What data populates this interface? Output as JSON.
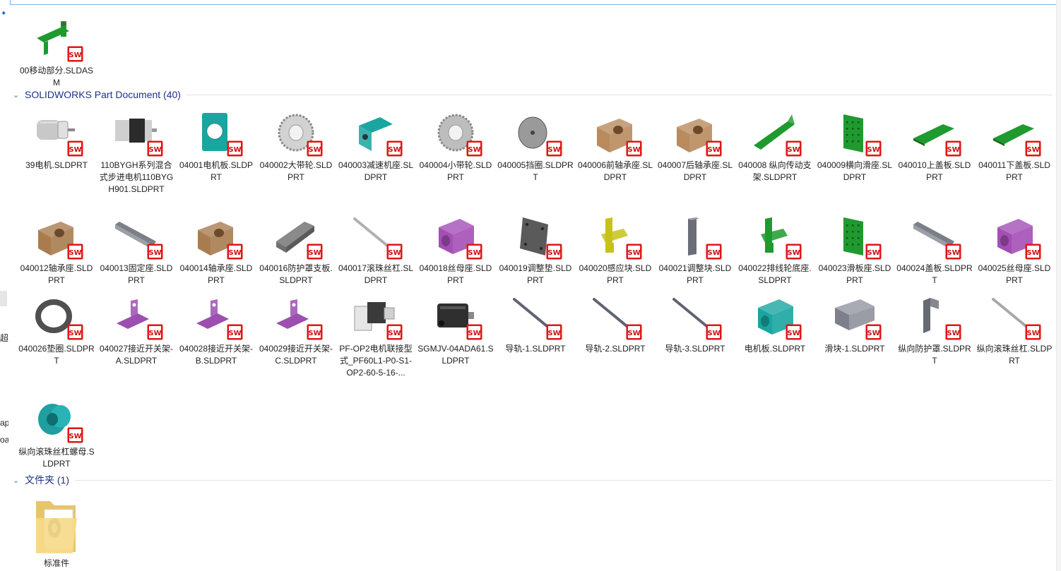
{
  "nav_fragments": [
    "超",
    "ap",
    "oa"
  ],
  "asm_item": {
    "label": "00移动部分.SLDASM",
    "color": "#1f9a2e",
    "shape": "assembly"
  },
  "group_parts": {
    "title": "SOLIDWORKS Part Document (40)"
  },
  "group_folder": {
    "title": "文件夹 (1)"
  },
  "sw_badge_text": "SW",
  "folder_item": {
    "label": "标准件",
    "shape": "folder"
  },
  "parts": [
    {
      "label": "39电机.SLDPRT",
      "color": "#c8c8c8",
      "shape": "motor"
    },
    {
      "label": "110BYGH系列混合式步进电机110BYGH901.SLDPRT",
      "color": "#2b2b2b",
      "shape": "stepper"
    },
    {
      "label": "04001电机板.SLDPRT",
      "color": "#19a5a0",
      "shape": "plate-hole"
    },
    {
      "label": "040002大带轮.SLDPRT",
      "color": "#d2d2d2",
      "shape": "gear"
    },
    {
      "label": "040003减速机座.SLDPRT",
      "color": "#19a5a0",
      "shape": "bracket"
    },
    {
      "label": "040004小带轮.SLDPRT",
      "color": "#bdbdbd",
      "shape": "gear"
    },
    {
      "label": "040005挡圈.SLDPRT",
      "color": "#9a9a9a",
      "shape": "disc"
    },
    {
      "label": "040006前轴承座.SLDPRT",
      "color": "#b98b5e",
      "shape": "block"
    },
    {
      "label": "040007后轴承座.SLDPRT",
      "color": "#b98b5e",
      "shape": "block"
    },
    {
      "label": "040008 纵向传动支架.SLDPRT",
      "color": "#1f9a2e",
      "shape": "rail-plate"
    },
    {
      "label": "040009横向滑座.SLDPRT",
      "color": "#1f9a2e",
      "shape": "panel"
    },
    {
      "label": "040010上盖板.SLDPRT",
      "color": "#1f9a2e",
      "shape": "flat"
    },
    {
      "label": "040011下盖板.SLDPRT",
      "color": "#1f9a2e",
      "shape": "flat"
    },
    {
      "label": "040012轴承座.SLDPRT",
      "color": "#a97c50",
      "shape": "block"
    },
    {
      "label": "040013固定座.SLDPRT",
      "color": "#7a7f88",
      "shape": "bar"
    },
    {
      "label": "040014轴承座.SLDPRT",
      "color": "#a97c50",
      "shape": "block"
    },
    {
      "label": "040016防护罩支板.SLDPRT",
      "color": "#6f6f6f",
      "shape": "channel"
    },
    {
      "label": "040017滚珠丝杠.SLDPRT",
      "color": "#b0b0b0",
      "shape": "rod"
    },
    {
      "label": "040018丝母座.SLDPRT",
      "color": "#a44fb5",
      "shape": "cube-hole"
    },
    {
      "label": "040019调整垫.SLDPRT",
      "color": "#5a5a5a",
      "shape": "pad"
    },
    {
      "label": "040020感应块.SLDPRT",
      "color": "#c6c21a",
      "shape": "lug"
    },
    {
      "label": "040021调整块.SLDPRT",
      "color": "#6b6e78",
      "shape": "slab"
    },
    {
      "label": "040022排线轮底座.SLDPRT",
      "color": "#1f9a2e",
      "shape": "lug"
    },
    {
      "label": "040023滑板座.SLDPRT",
      "color": "#1f9a2e",
      "shape": "panel"
    },
    {
      "label": "040024盖板.SLDPRT",
      "color": "#7a7f88",
      "shape": "bar"
    },
    {
      "label": "040025丝母座.SLDPRT",
      "color": "#a44fb5",
      "shape": "cube-hole"
    },
    {
      "label": "040026垫圈.SLDPRT",
      "color": "#505050",
      "shape": "ring"
    },
    {
      "label": "040027接近开关架-A.SLDPRT",
      "color": "#9c4fb0",
      "shape": "angle"
    },
    {
      "label": "040028接近开关架-B.SLDPRT",
      "color": "#9c4fb0",
      "shape": "angle"
    },
    {
      "label": "040029接近开关架-C.SLDPRT",
      "color": "#9c4fb0",
      "shape": "angle"
    },
    {
      "label": "PF-OP2电机联接型式_PF60L1-P0-S1-OP2-60-5-16-...",
      "color": "#3a3a3a",
      "shape": "gearbox"
    },
    {
      "label": "SGMJV-04ADA61.SLDPRT",
      "color": "#2f2f2f",
      "shape": "servo"
    },
    {
      "label": "导轨-1.SLDPRT",
      "color": "#5f6470",
      "shape": "rod"
    },
    {
      "label": "导轨-2.SLDPRT",
      "color": "#5f6470",
      "shape": "rod"
    },
    {
      "label": "导轨-3.SLDPRT",
      "color": "#5f6470",
      "shape": "rod"
    },
    {
      "label": "电机板.SLDPRT",
      "color": "#19a5a0",
      "shape": "cube-hole"
    },
    {
      "label": "滑块-1.SLDPRT",
      "color": "#7d808a",
      "shape": "slider"
    },
    {
      "label": "纵向防护罩.SLDPRT",
      "color": "#666a72",
      "shape": "hook"
    },
    {
      "label": "纵向滚珠丝杠.SLDPRT",
      "color": "#a8a8a8",
      "shape": "rod"
    },
    {
      "label": "纵向滚珠丝杠螺母.SLDPRT",
      "color": "#1f9fa0",
      "shape": "flange"
    }
  ]
}
